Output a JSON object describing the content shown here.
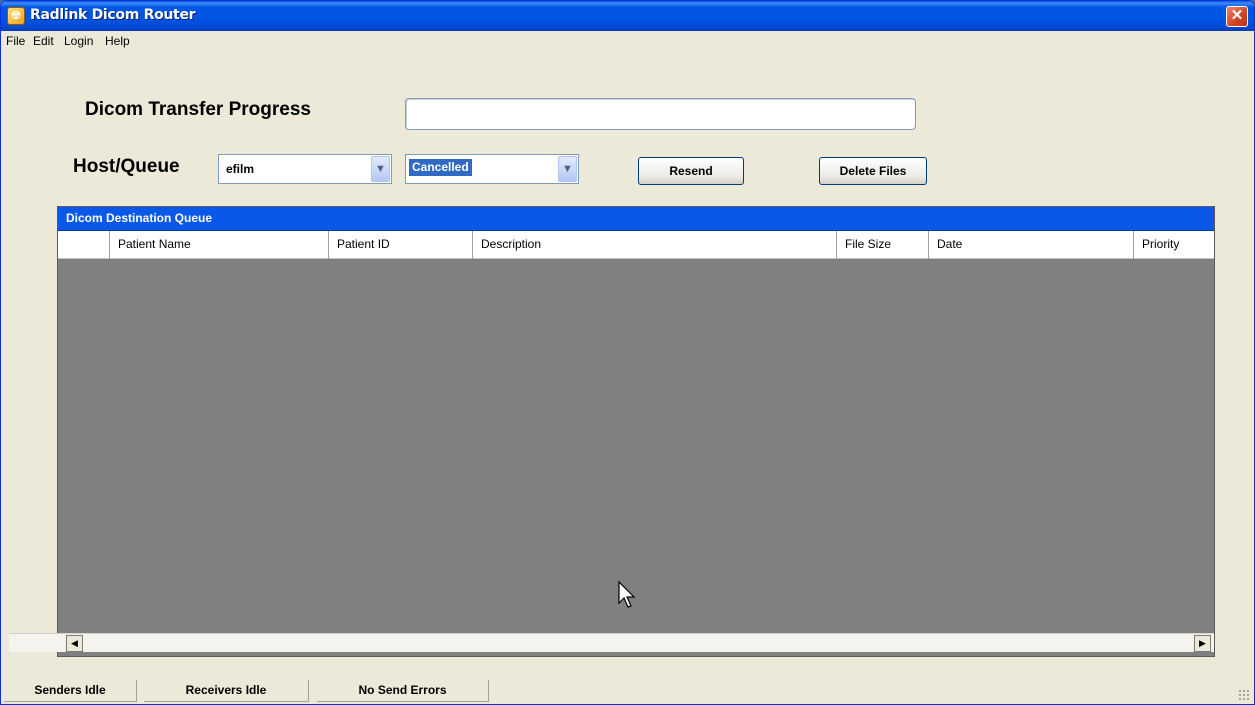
{
  "window": {
    "title": "Radlink Dicom Router",
    "close_glyph": "✕",
    "icon": "radlink-app-icon"
  },
  "menu": [
    "File",
    "Edit",
    "Login",
    "Help"
  ],
  "progress": {
    "label": "Dicom Transfer Progress",
    "value": 0
  },
  "host_queue": {
    "label": "Host/Queue",
    "host_value": "efilm",
    "queue_value": "Cancelled"
  },
  "buttons": {
    "resend": "Resend",
    "delete_files": "Delete Files"
  },
  "grid": {
    "caption": "Dicom Destination Queue",
    "columns": [
      "Patient Name",
      "Patient ID",
      "Description",
      "File Size",
      "Date",
      "Priority"
    ],
    "rows": []
  },
  "status": {
    "senders": "Senders Idle",
    "receivers": "Receivers Idle",
    "errors": "No Send Errors"
  }
}
